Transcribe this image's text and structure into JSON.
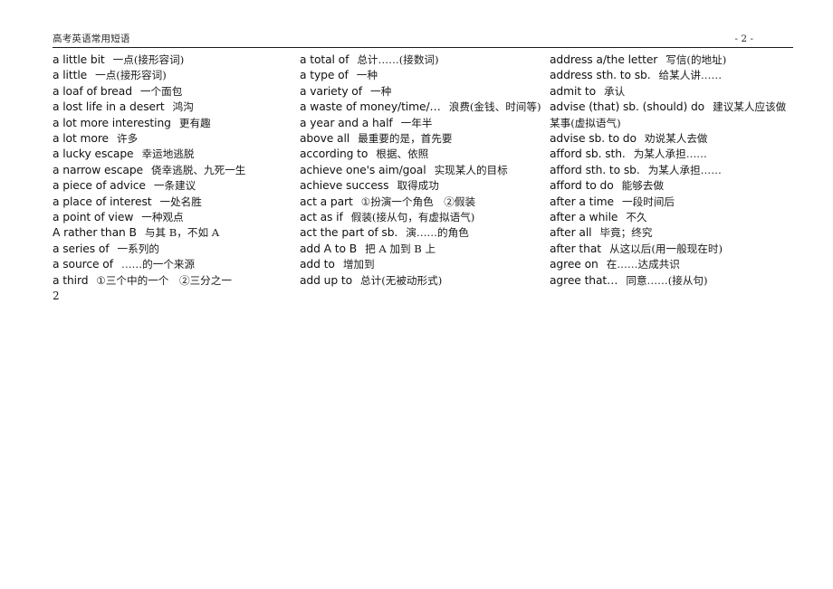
{
  "header": {
    "title": "高考英语常用短语",
    "page_number": "- 2 -"
  },
  "columns": [
    {
      "name": "column-1",
      "entries": [
        {
          "en": "a little bit",
          "cn": "一点(接形容词)"
        },
        {
          "en": "a little",
          "cn": "一点(接形容词)"
        },
        {
          "en": "a loaf of bread",
          "cn": "一个面包"
        },
        {
          "en": "a lost life in a desert",
          "cn": "鸿沟"
        },
        {
          "en": "a lot more interesting",
          "cn": "更有趣"
        },
        {
          "en": "a lot more",
          "cn": "许多"
        },
        {
          "en": "a lucky escape",
          "cn": "幸运地逃脱"
        },
        {
          "en": "a narrow escape",
          "cn": "侥幸逃脱、九死一生"
        },
        {
          "en": "a piece of advice",
          "cn": "一条建议"
        },
        {
          "en": "a place of interest",
          "cn": "一处名胜"
        },
        {
          "en": "a point of view",
          "cn": "一种观点"
        },
        {
          "en": "A rather than B",
          "cn": "与其 B，不如 A"
        },
        {
          "en": "a series of",
          "cn": "一系列的"
        },
        {
          "en": "a source of",
          "cn": "……的一个来源"
        },
        {
          "en": "a third",
          "cn": "①三个中的一个　②三分之一"
        }
      ],
      "trailing_text": "2"
    },
    {
      "name": "column-2",
      "entries": [
        {
          "en": "a total of",
          "cn": "总计……(接数词)"
        },
        {
          "en": "a type of",
          "cn": "一种"
        },
        {
          "en": "a variety of",
          "cn": "一种"
        },
        {
          "en": "a waste of money/time/…",
          "cn": "浪费(金钱、时间等)"
        },
        {
          "en": "a year and a half",
          "cn": "一年半"
        },
        {
          "en": "above all",
          "cn": "最重要的是，首先要"
        },
        {
          "en": "according to",
          "cn": "根据、依照"
        },
        {
          "en": "achieve one's aim/goal",
          "cn": "实现某人的目标"
        },
        {
          "en": "achieve success",
          "cn": "取得成功"
        },
        {
          "en": "act a part",
          "cn": "①扮演一个角色　②假装"
        },
        {
          "en": "act as if",
          "cn": "假装(接从句，有虚拟语气)"
        },
        {
          "en": "act the part of sb.",
          "cn": "演……的角色"
        },
        {
          "en": "add A to B",
          "cn": "把 A 加到 B 上"
        },
        {
          "en": "add to",
          "cn": "增加到"
        },
        {
          "en": "add up to",
          "cn": "总计(无被动形式)"
        }
      ],
      "trailing_text": ""
    },
    {
      "name": "column-3",
      "entries": [
        {
          "en": "address a/the letter",
          "cn": "写信(的地址)"
        },
        {
          "en": "address sth. to sb.",
          "cn": "给某人讲……"
        },
        {
          "en": "admit to",
          "cn": "承认"
        },
        {
          "en": "advise (that) sb. (should) do",
          "cn": "建议某人应该做某事(虚拟语气)"
        },
        {
          "en": "advise sb. to do",
          "cn": "劝说某人去做"
        },
        {
          "en": "afford sb. sth.",
          "cn": "为某人承担……"
        },
        {
          "en": "afford sth. to sb.",
          "cn": "为某人承担……"
        },
        {
          "en": "afford to do",
          "cn": "能够去做"
        },
        {
          "en": "after a time",
          "cn": "一段时间后"
        },
        {
          "en": "after a while",
          "cn": "不久"
        },
        {
          "en": "after all",
          "cn": "毕竟；终究"
        },
        {
          "en": "after that",
          "cn": "从这以后(用一般现在时)"
        },
        {
          "en": "agree on",
          "cn": "在……达成共识"
        },
        {
          "en": "agree that…",
          "cn": "同意……(接从句)"
        }
      ],
      "trailing_text": ""
    }
  ]
}
